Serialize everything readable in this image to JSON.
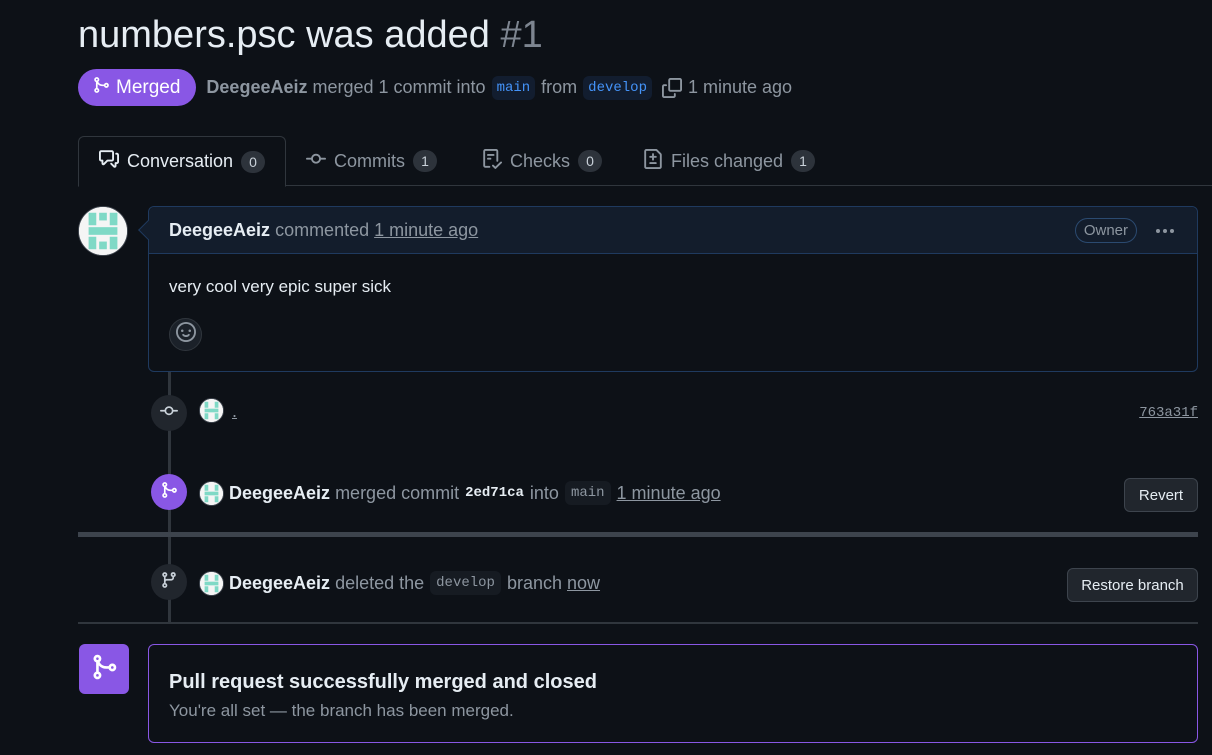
{
  "pr": {
    "title": "numbers.psc was added",
    "number": "#1"
  },
  "meta": {
    "status_label": "Merged",
    "author": "DeegeeAeiz",
    "merged_text": "merged 1 commit into",
    "base_branch": "main",
    "from_text": "from",
    "head_branch": "develop",
    "time": "1 minute ago"
  },
  "tabs": [
    {
      "label": "Conversation",
      "count": "0",
      "icon": "comment-discussion-icon"
    },
    {
      "label": "Commits",
      "count": "1",
      "icon": "git-commit-icon"
    },
    {
      "label": "Checks",
      "count": "0",
      "icon": "checklist-icon"
    },
    {
      "label": "Files changed",
      "count": "1",
      "icon": "file-diff-icon"
    }
  ],
  "comment": {
    "author": "DeegeeAeiz",
    "action": "commented",
    "time": "1 minute ago",
    "role_badge": "Owner",
    "body": "very cool very epic super sick"
  },
  "timeline": {
    "commit": {
      "message": ".",
      "sha": "763a31f"
    },
    "merge": {
      "author": "DeegeeAeiz",
      "text_merged": "merged commit",
      "sha": "2ed71ca",
      "text_into": "into",
      "branch": "main",
      "time": "1 minute ago",
      "button": "Revert"
    },
    "delete": {
      "author": "DeegeeAeiz",
      "text_deleted": "deleted the",
      "branch": "develop",
      "text_branch": "branch",
      "time": "now",
      "button": "Restore branch"
    }
  },
  "merged_box": {
    "title": "Pull request successfully merged and closed",
    "subtitle": "You're all set — the branch has been merged."
  },
  "colors": {
    "background": "#0d1117",
    "merged_purple": "#8957e5",
    "link_blue": "#4493f8",
    "muted_text": "#8d96a0",
    "avatar_teal": "#7fd9c6"
  }
}
